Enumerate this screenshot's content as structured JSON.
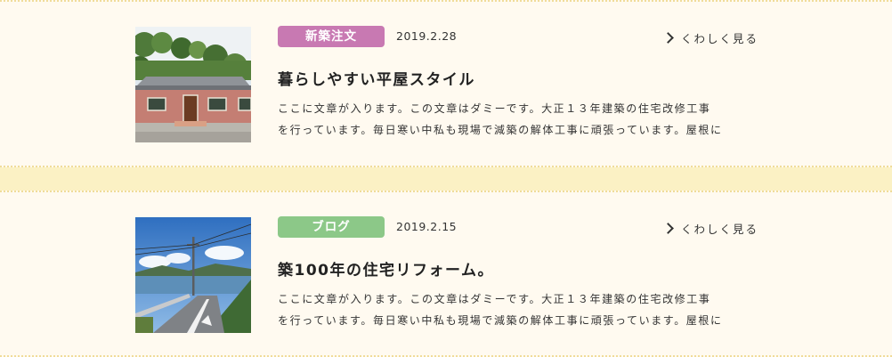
{
  "posts": [
    {
      "category": "新築注文",
      "category_color": "#c879b2",
      "date": "2019.2.28",
      "more_label": "くわしく見る",
      "title": "暮らしやすい平屋スタイル",
      "excerpt_lines": [
        "ここに文章が入ります。この文章はダミーです。大正１３年建築の住宅改修工事",
        "を行っています。毎日寒い中私も現場で減築の解体工事に頑張っています。屋根に"
      ],
      "image": "one-story house photo"
    },
    {
      "category": "ブログ",
      "category_color": "#8cc888",
      "date": "2019.2.15",
      "more_label": "くわしく見る",
      "title": "築100年の住宅リフォーム。",
      "excerpt_lines": [
        "ここに文章が入ります。この文章はダミーです。大正１３年建築の住宅改修工事",
        "を行っています。毎日寒い中私も現場で減築の解体工事に頑張っています。屋根に"
      ],
      "image": "coastal road photo"
    }
  ]
}
